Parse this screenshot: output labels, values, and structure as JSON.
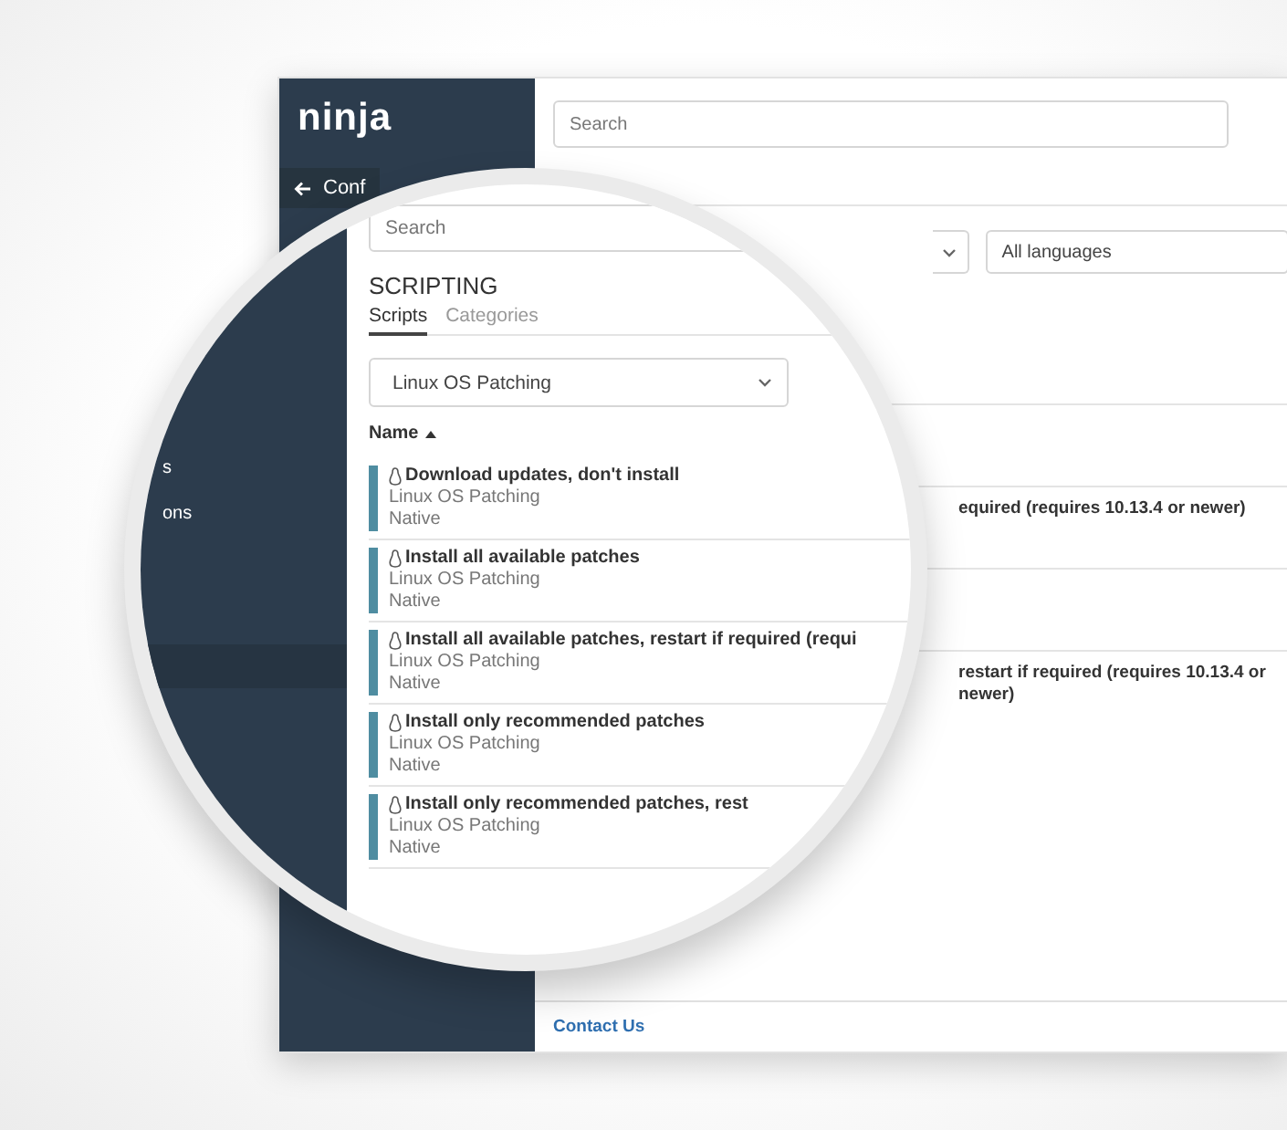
{
  "sidebar": {
    "logo": "ninja",
    "back_label": "Conf"
  },
  "search": {
    "placeholder": "Search"
  },
  "filters": {
    "language_select": {
      "value": "All languages"
    }
  },
  "rows": [
    {},
    {
      "text": "equired (requires 10.13.4 or newer)"
    },
    {},
    {
      "text": "restart if required (requires 10.13.4 or newer)"
    }
  ],
  "footer": {
    "link": "Contact Us"
  },
  "magnifier": {
    "sidebar_items": [
      {
        "label": "s",
        "selected": false
      },
      {
        "label": "ons",
        "selected": false
      }
    ],
    "search": {
      "placeholder": "Search"
    },
    "heading": "SCRIPTING",
    "tabs": [
      {
        "label": "Scripts",
        "selected": true
      },
      {
        "label": "Categories",
        "selected": false
      }
    ],
    "category_select": {
      "value": "Linux OS Patching"
    },
    "sort_column": {
      "label": "Name",
      "ascending": true
    },
    "scripts": [
      {
        "name": "Download updates, don't install",
        "category": "Linux OS Patching",
        "language": "Native"
      },
      {
        "name": "Install all available patches",
        "category": "Linux OS Patching",
        "language": "Native"
      },
      {
        "name": "Install all available patches, restart if required (requi",
        "category": "Linux OS Patching",
        "language": "Native"
      },
      {
        "name": "Install only recommended patches",
        "category": "Linux OS Patching",
        "language": "Native"
      },
      {
        "name": "Install only recommended patches, rest",
        "category": "Linux OS Patching",
        "language": "Native"
      }
    ]
  }
}
